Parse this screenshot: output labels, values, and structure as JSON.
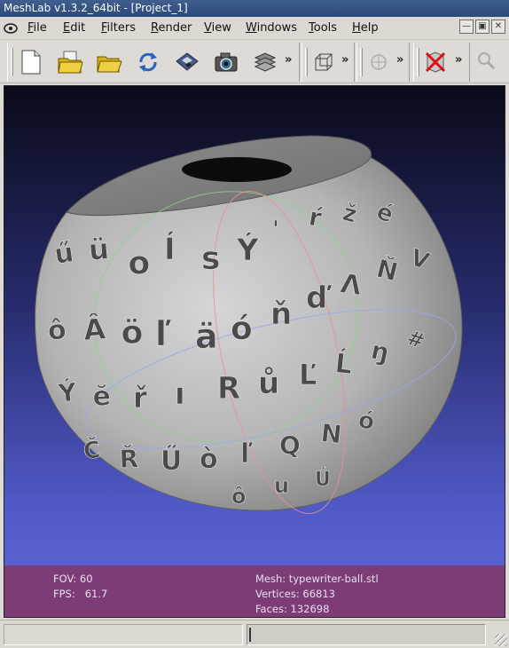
{
  "window": {
    "title": "MeshLab v1.3.2_64bit - [Project_1]"
  },
  "menu": {
    "items": [
      "File",
      "Edit",
      "Filters",
      "Render",
      "View",
      "Windows",
      "Tools",
      "Help"
    ],
    "window_controls": [
      "minimize-icon",
      "restore-icon",
      "close-icon"
    ]
  },
  "toolbar": {
    "groups": [
      {
        "buttons": [
          "new-document-icon",
          "open-project-icon",
          "open-mesh-icon",
          "reload-icon",
          "save-icon",
          "snapshot-icon",
          "layers-icon"
        ],
        "overflow": "»"
      },
      {
        "buttons": [
          "bounding-box-icon"
        ],
        "overflow": "»"
      },
      {
        "buttons": [
          "globe-icon"
        ],
        "overflow": "»"
      },
      {
        "buttons": [
          "delete-icon"
        ],
        "overflow": "»"
      },
      {
        "buttons": [
          "magnifier-icon"
        ]
      }
    ]
  },
  "viewport": {
    "info": {
      "fov": "FOV: 60",
      "fps": "FPS:   61.7",
      "mesh": "Mesh: typewriter-ball.stl",
      "vertices": "Vertices: 66813",
      "faces": "Faces: 132698"
    },
    "background_colors": [
      "#0a0a18",
      "#4f58c4",
      "#6268d8"
    ],
    "overlay_color": "#803870",
    "glyphs": [
      "ű",
      "ü",
      "o",
      "Í",
      "s",
      "Ý",
      "'",
      "ŕ",
      "ž",
      "é",
      "ô",
      "Â",
      "ö",
      "ľ",
      "ä",
      "ó",
      "ň",
      "ď",
      "Λ",
      "Ň",
      "V",
      "Ý",
      "ĕ",
      "ř",
      "ı",
      "R",
      "ů",
      "Ľ",
      "Ĺ",
      "ŋ",
      "#",
      "Č",
      "Ř",
      "Ű",
      "ò",
      "ľ",
      "Q",
      "N",
      "ó",
      "ô",
      "u",
      "Ú"
    ]
  },
  "statusbar": {
    "text": ""
  }
}
